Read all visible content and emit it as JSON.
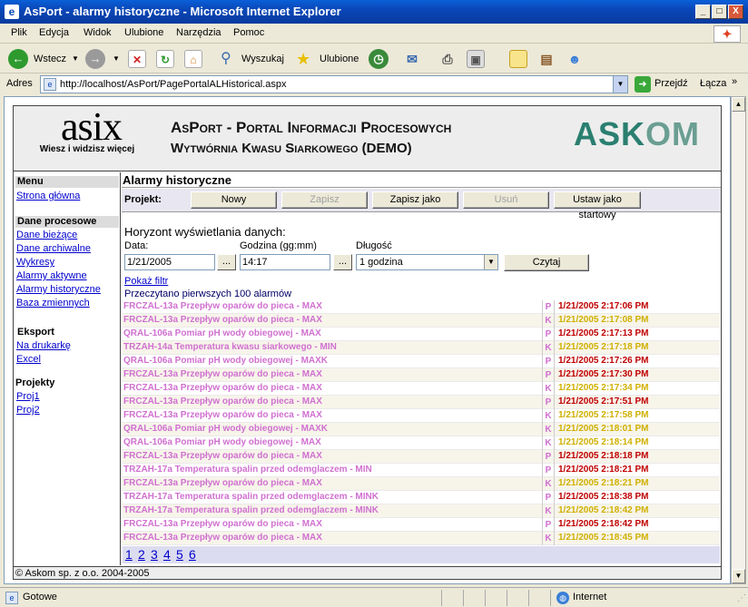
{
  "window": {
    "title": "AsPort - alarmy historyczne - Microsoft Internet Explorer",
    "minimize": "_",
    "maximize": "□",
    "close": "X"
  },
  "menu": [
    "Plik",
    "Edycja",
    "Widok",
    "Ulubione",
    "Narzędzia",
    "Pomoc"
  ],
  "toolbar": {
    "back": "Wstecz",
    "search": "Wyszukaj",
    "favorites": "Ulubione"
  },
  "address": {
    "label": "Adres",
    "url": "http://localhost/AsPort/PagePortalALHistorical.aspx",
    "go": "Przejdź",
    "links": "Łącza",
    "chevron": "»"
  },
  "header": {
    "logo_text": "asix",
    "logo_tagline": "Wiesz i widzisz więcej",
    "title": "AsPort - Portal Informacji Procesowych",
    "subtitle": "Wytwórnia Kwasu Siarkowego (DEMO)",
    "brand_a": "ASK",
    "brand_b": "OM"
  },
  "sidebar": {
    "menu_title": "Menu",
    "home": "Strona główna",
    "process_title": "Dane procesowe",
    "process_items": [
      "Dane bieżące",
      "Dane archiwalne",
      "Wykresy",
      "Alarmy aktywne",
      "Alarmy historyczne",
      "Baza zmiennych"
    ],
    "export_title": "Eksport",
    "export_items": [
      "Na drukarkę",
      "Excel"
    ],
    "projects_title": "Projekty",
    "projects_items": [
      "Proj1",
      "Proj2"
    ]
  },
  "main": {
    "title": "Alarmy historyczne",
    "project_label": "Projekt:",
    "buttons": {
      "new": "Nowy",
      "save": "Zapisz",
      "save_as": "Zapisz jako",
      "delete": "Usuń",
      "set_start": "Ustaw jako startowy"
    },
    "horizon": "Horyzont wyświetlania danych:",
    "date_label": "Data:",
    "time_label": "Godzina (gg:mm)",
    "duration_label": "Długość",
    "date_value": "1/21/2005",
    "time_value": "14:17",
    "duration_value": "1 godzina",
    "dots": "...",
    "read_button": "Czytaj",
    "show_filter": "Pokaż filtr",
    "read_info": "Przeczytano pierwszych 100 alarmów"
  },
  "alarms": [
    {
      "text": "FRCZAL-13a Przepływ oparów do pieca - MAX",
      "type": "P",
      "time": "1/21/2005 2:17:06 PM"
    },
    {
      "text": "FRCZAL-13a Przepływ oparów do pieca - MAX",
      "type": "K",
      "time": "1/21/2005 2:17:08 PM"
    },
    {
      "text": "QRAL-106a Pomiar pH wody obiegowej - MAX",
      "type": "P",
      "time": "1/21/2005 2:17:13 PM"
    },
    {
      "text": "TRZAH-14a Temperatura kwasu siarkowego - MIN",
      "type": "K",
      "time": "1/21/2005 2:17:18 PM"
    },
    {
      "text": "QRAL-106a Pomiar pH wody obiegowej - MAXK",
      "type": "P",
      "time": "1/21/2005 2:17:26 PM"
    },
    {
      "text": "FRCZAL-13a Przepływ oparów do pieca - MAX",
      "type": "P",
      "time": "1/21/2005 2:17:30 PM"
    },
    {
      "text": "FRCZAL-13a Przepływ oparów do pieca - MAX",
      "type": "K",
      "time": "1/21/2005 2:17:34 PM"
    },
    {
      "text": "FRCZAL-13a Przepływ oparów do pieca - MAX",
      "type": "P",
      "time": "1/21/2005 2:17:51 PM"
    },
    {
      "text": "FRCZAL-13a Przepływ oparów do pieca - MAX",
      "type": "K",
      "time": "1/21/2005 2:17:58 PM"
    },
    {
      "text": "QRAL-106a Pomiar pH wody obiegowej - MAXK",
      "type": "K",
      "time": "1/21/2005 2:18:01 PM"
    },
    {
      "text": "QRAL-106a Pomiar pH wody obiegowej - MAX",
      "type": "K",
      "time": "1/21/2005 2:18:14 PM"
    },
    {
      "text": "FRCZAL-13a Przepływ oparów do pieca - MAX",
      "type": "P",
      "time": "1/21/2005 2:18:18 PM"
    },
    {
      "text": "TRZAH-17a Temperatura spalin przed odemglaczem - MIN",
      "type": "P",
      "time": "1/21/2005 2:18:21 PM"
    },
    {
      "text": "FRCZAL-13a Przepływ oparów do pieca - MAX",
      "type": "K",
      "time": "1/21/2005 2:18:21 PM"
    },
    {
      "text": "TRZAH-17a Temperatura spalin przed odemglaczem - MINK",
      "type": "P",
      "time": "1/21/2005 2:18:38 PM"
    },
    {
      "text": "TRZAH-17a Temperatura spalin przed odemglaczem - MINK",
      "type": "K",
      "time": "1/21/2005 2:18:42 PM"
    },
    {
      "text": "FRCZAL-13a Przepływ oparów do pieca - MAX",
      "type": "P",
      "time": "1/21/2005 2:18:42 PM"
    },
    {
      "text": "FRCZAL-13a Przepływ oparów do pieca - MAX",
      "type": "K",
      "time": "1/21/2005 2:18:45 PM"
    }
  ],
  "pages": [
    "1",
    "2",
    "3",
    "4",
    "5",
    "6"
  ],
  "footer": "© Askom sp. z o.o. 2004-2005",
  "status": {
    "text": "Gotowe",
    "zone": "Internet"
  },
  "colors": {
    "alarm_text": "#d070d0",
    "time_p": "#c00000",
    "time_k": "#d0b000",
    "brand": "#2a7f70"
  }
}
